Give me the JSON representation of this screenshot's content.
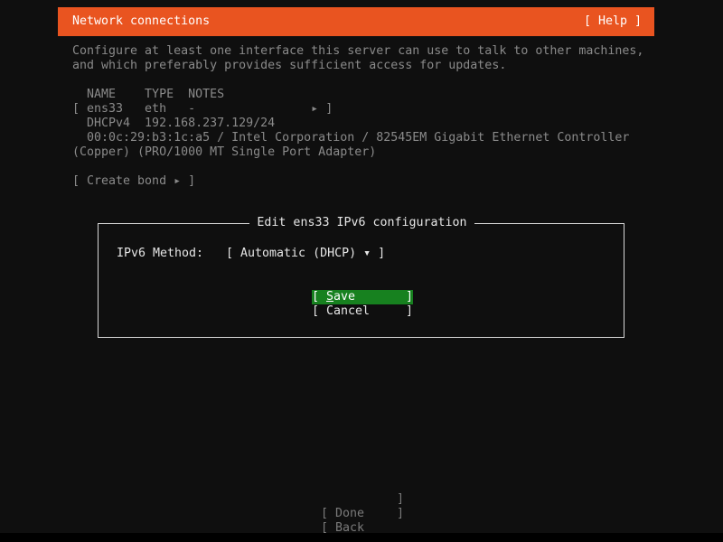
{
  "header": {
    "title": "Network connections",
    "help": "[ Help ]"
  },
  "intro": {
    "line1": "Configure at least one interface this server can use to talk to other machines,",
    "line2": "and which preferably provides sufficient access for updates."
  },
  "table": {
    "headers": "  NAME    TYPE  NOTES",
    "row1": "[ ens33   eth   -                ▸ ]",
    "row2": "  DHCPv4  192.168.237.129/24",
    "row3": "  00:0c:29:b3:1c:a5 / Intel Corporation / 82545EM Gigabit Ethernet Controller",
    "row4": "(Copper) (PRO/1000 MT Single Port Adapter)"
  },
  "create_bond": "[ Create bond ▸ ]",
  "dialog": {
    "title": "Edit ens33 IPv6 configuration",
    "method_label": "IPv6 Method:",
    "method_value": "[ Automatic (DHCP) ▾ ]",
    "save_prefix": "[ ",
    "save_first": "S",
    "save_rest": "ave",
    "save_close": "]",
    "cancel_open": "[",
    "cancel_label": "Cancel",
    "cancel_close": "]"
  },
  "footer": {
    "done_label": "[ Done",
    "done_close": "]",
    "back_label": "[ Back",
    "back_close": "]"
  },
  "colors": {
    "header_bg": "#e95420",
    "focus_bg": "#17811f",
    "background": "#0f0f0f"
  }
}
